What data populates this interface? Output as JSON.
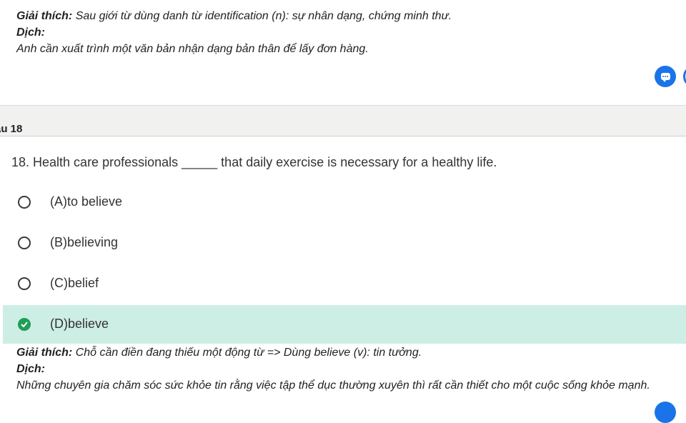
{
  "prev_explanation": {
    "giai_thich_label": "Giải thích:",
    "giai_thich_text": "Sau giới từ dùng danh từ identification (n): sự nhân dạng, chứng minh thư.",
    "dich_label": "Dịch:",
    "dich_text": "Anh cần xuất trình một văn bản nhận dạng bản thân để lấy đơn hàng."
  },
  "question": {
    "header": "âu 18",
    "text": "18. Health care professionals _____ that daily exercise is necessary for a healthy life.",
    "options": [
      {
        "label": "(A)to believe",
        "selected": false
      },
      {
        "label": "(B)believing",
        "selected": false
      },
      {
        "label": "(C)belief",
        "selected": false
      },
      {
        "label": "(D)believe",
        "selected": true
      }
    ]
  },
  "explanation": {
    "giai_thich_label": "Giải thích:",
    "giai_thich_text": "Chỗ cần điền đang thiếu một động từ => Dùng believe (v): tin tưởng.",
    "dich_label": "Dịch:",
    "dich_text": "Những chuyên gia chăm sóc sức khỏe tin rằng việc tập thể dục thường xuyên thì rất cần thiết cho một cuộc sống khỏe mạnh."
  },
  "colors": {
    "accent": "#1a73e8",
    "selected_bg": "#cdeee4",
    "check": "#1e9e57",
    "header_bg": "#f1f1ef"
  },
  "icons": [
    "comment-icon",
    "check-circle-icon",
    "radio-icon"
  ]
}
